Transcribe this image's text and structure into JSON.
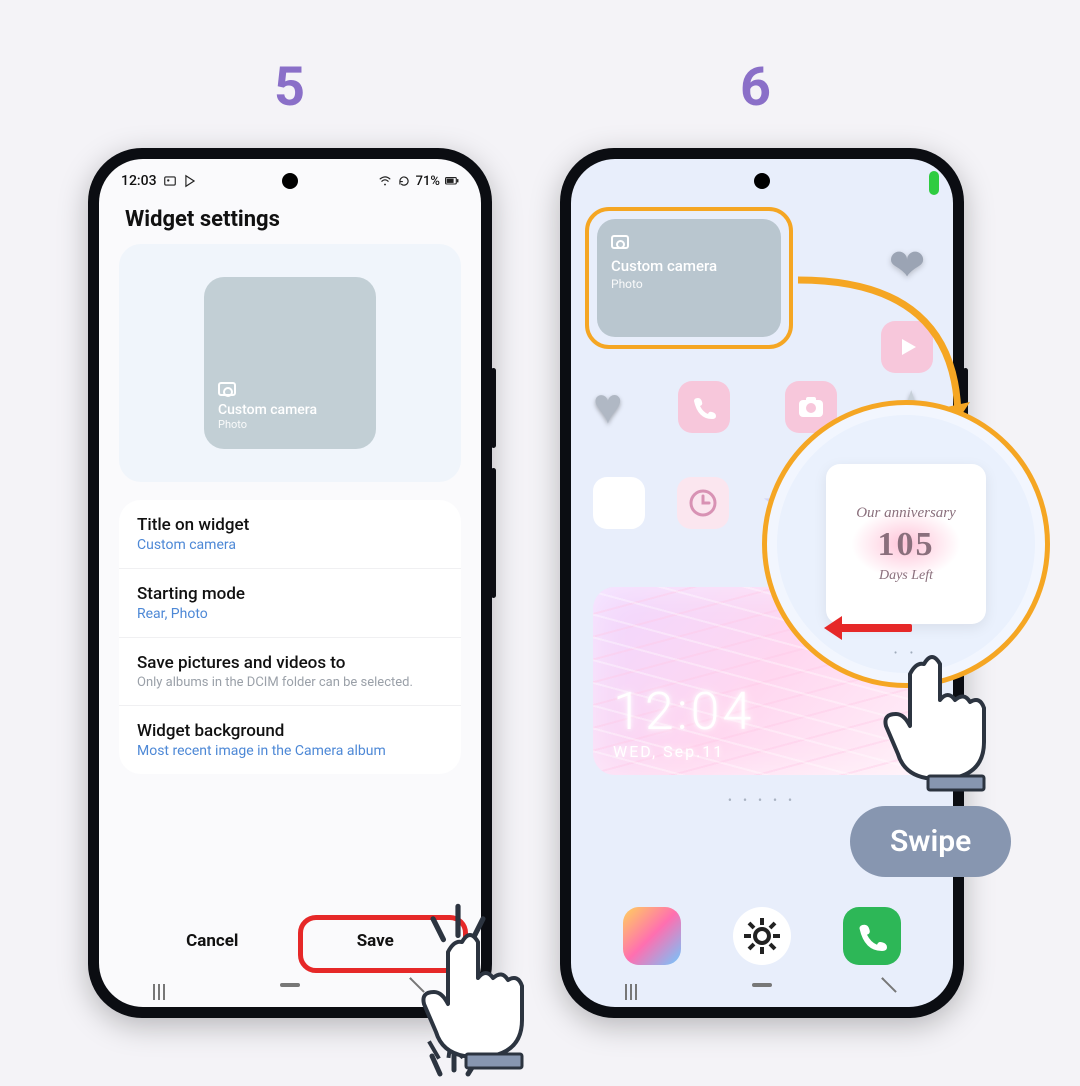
{
  "steps": {
    "s5": "5",
    "s6": "6"
  },
  "status": {
    "time": "12:03",
    "battery": "71%"
  },
  "p5": {
    "title": "Widget settings",
    "widget": {
      "title": "Custom camera",
      "sub": "Photo"
    },
    "items": [
      {
        "label": "Title on widget",
        "val": "Custom camera"
      },
      {
        "label": "Starting mode",
        "val": "Rear, Photo"
      },
      {
        "label": "Save pictures and videos to",
        "desc": "Only albums in the DCIM folder can be selected."
      },
      {
        "label": "Widget background",
        "val": "Most recent image in the Camera album"
      }
    ],
    "cancel": "Cancel",
    "save": "Save"
  },
  "p6": {
    "widget": {
      "title": "Custom camera",
      "sub": "Photo"
    },
    "clock": {
      "time": "12:04",
      "date": "WED, Sep.11"
    }
  },
  "magnifier": {
    "line1": "Our anniversary",
    "count": "105",
    "line2": "Days Left"
  },
  "swipe": "Swipe"
}
